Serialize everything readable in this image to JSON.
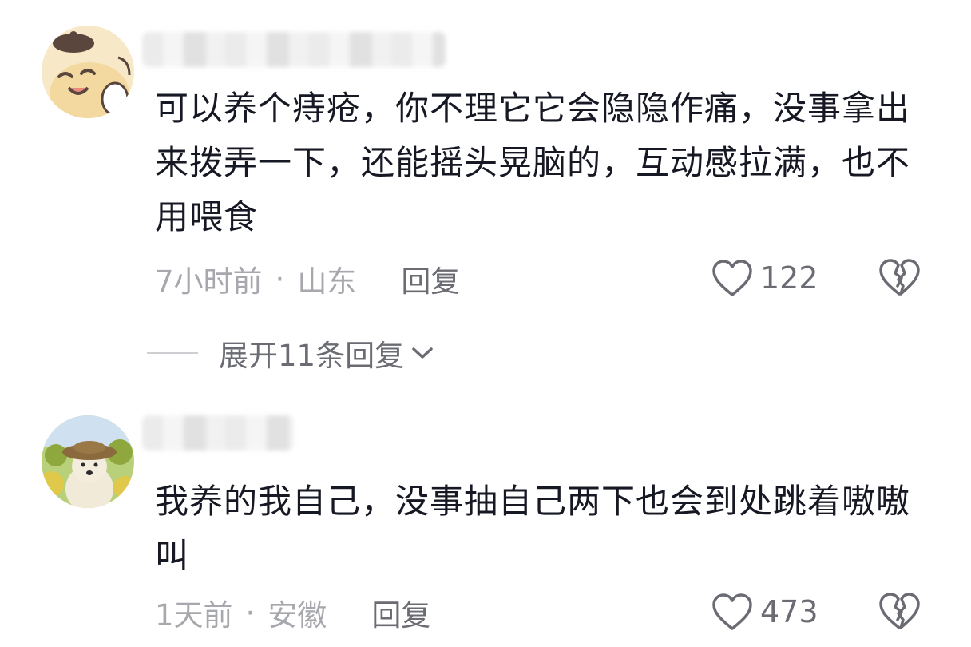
{
  "comments": [
    {
      "avatar_icon": "cartoon-cat-avatar",
      "text": "可以养个痔疮，你不理它它会隐隐作痛，没事拿出来拨弄一下，还能摇头晃脑的，互动感拉满，也不用喂食",
      "time": "7小时前",
      "separator": "·",
      "location": "山东",
      "reply_label": "回复",
      "likes": "122"
    },
    {
      "avatar_icon": "dog-photo-avatar",
      "text": "我养的我自己，没事抽自己两下也会到处跳着嗷嗷叫",
      "time": "1天前",
      "separator": "·",
      "location": "安徽",
      "reply_label": "回复",
      "likes": "473"
    }
  ],
  "expand_replies": {
    "label": "展开11条回复",
    "icon": "chevron-down-icon"
  },
  "icons": {
    "like": "heart-outline-icon",
    "dislike": "broken-heart-icon"
  },
  "colors": {
    "text_primary": "#161823",
    "text_meta": "#a7a8ad",
    "text_secondary": "#6b6c73"
  }
}
